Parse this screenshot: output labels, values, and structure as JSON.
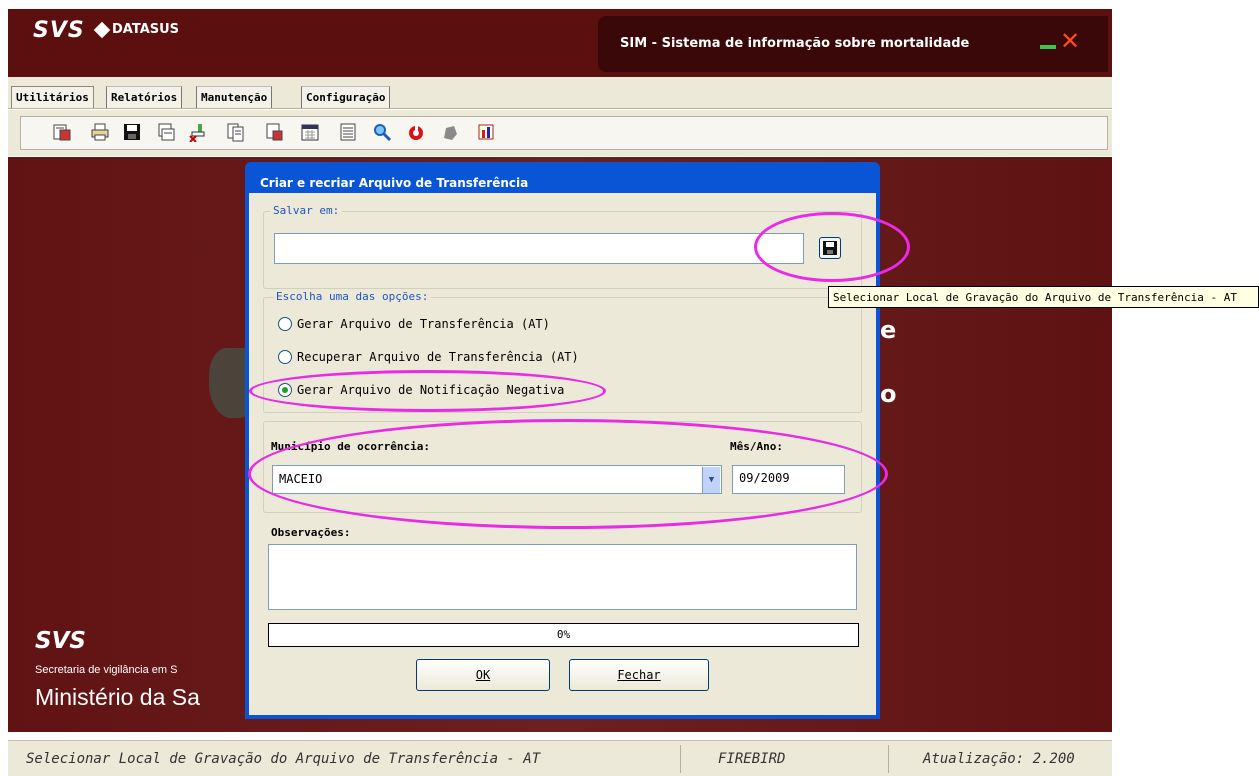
{
  "window": {
    "logo_svs": "SVS",
    "logo_datasus": "DATASUS",
    "title": "SIM - Sistema de informação sobre mortalidade"
  },
  "menu": {
    "tabs": [
      "Utilitários",
      "Relatórios",
      "Manutenção",
      "Configuração"
    ]
  },
  "toolbar": {
    "icons": [
      "import-icon",
      "print-icon",
      "save-icon",
      "export-icon",
      "transfer-icon",
      "copy-icon",
      "report-icon",
      "calendar-icon",
      "list-icon",
      "search-icon",
      "power-icon",
      "gear-icon",
      "chart-icon"
    ]
  },
  "background": {
    "letter_1": "e",
    "letter_2": "o",
    "footer_logo": "SVS",
    "secretaria": "Secretaria de vigilância em S",
    "ministerio": "Ministério da Sa"
  },
  "dialog": {
    "title": "Criar e recriar Arquivo de Transferência",
    "save_group_title": "Salvar em:",
    "save_path": "",
    "options_group_title": "Escolha uma das opções:",
    "options": [
      {
        "label": "Gerar Arquivo de Transferência (AT)",
        "checked": false
      },
      {
        "label": "Recuperar Arquivo de Transferência (AT)",
        "checked": false
      },
      {
        "label": "Gerar Arquivo de Notificação Negativa",
        "checked": true
      }
    ],
    "municipio_label": "Município de ocorrência:",
    "municipio_value": "MACEIO",
    "mesano_label": "Mês/Ano:",
    "mesano_value": "09/2009",
    "observacoes_label": "Observações:",
    "observacoes_value": "",
    "progress_text": "0%",
    "progress_value": 0,
    "ok_label": "OK",
    "close_label": "Fechar"
  },
  "tooltip": {
    "text": "Selecionar Local de Gravação do Arquivo de Transferência - AT"
  },
  "status": {
    "message": "Selecionar Local de Gravação do Arquivo de Transferência - AT",
    "database": "FIREBIRD",
    "version": "Atualização: 2.200"
  },
  "colors": {
    "title_bar": "#5b0f0f",
    "dialog_border": "#0a55d6",
    "annotation": "#ea2ae5"
  }
}
